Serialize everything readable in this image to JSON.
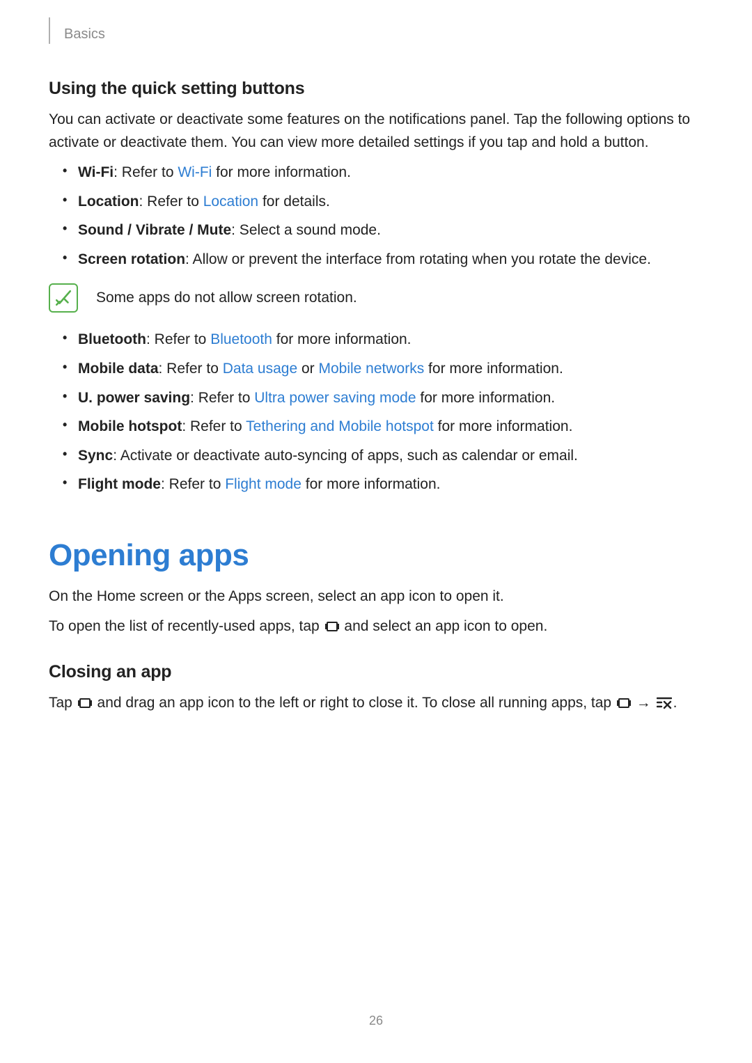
{
  "header": {
    "section": "Basics"
  },
  "section1": {
    "heading": "Using the quick setting buttons",
    "p1": "You can activate or deactivate some features on the notifications panel. Tap the following options to activate or deactivate them. You can view more detailed settings if you tap and hold a button.",
    "items1": [
      {
        "bold": "Wi-Fi",
        "pre": ": Refer to ",
        "link": "Wi-Fi",
        "post": " for more information."
      },
      {
        "bold": "Location",
        "pre": ": Refer to ",
        "link": "Location",
        "post": " for details."
      },
      {
        "bold": "Sound / Vibrate / Mute",
        "post_only": ": Select a sound mode."
      },
      {
        "bold": "Screen rotation",
        "post_only": ": Allow or prevent the interface from rotating when you rotate the device."
      }
    ],
    "note": "Some apps do not allow screen rotation.",
    "items2": [
      {
        "bold": "Bluetooth",
        "pre": ": Refer to ",
        "link": "Bluetooth",
        "post": " for more information."
      },
      {
        "bold": "Mobile data",
        "pre": ": Refer to ",
        "link": "Data usage",
        "mid": " or ",
        "link2": "Mobile networks",
        "post": " for more information."
      },
      {
        "bold": "U. power saving",
        "pre": ": Refer to ",
        "link": "Ultra power saving mode",
        "post": " for more information."
      },
      {
        "bold": "Mobile hotspot",
        "pre": ": Refer to ",
        "link": "Tethering and Mobile hotspot",
        "post": " for more information."
      },
      {
        "bold": "Sync",
        "post_only": ": Activate or deactivate auto-syncing of apps, such as calendar or email."
      },
      {
        "bold": "Flight mode",
        "pre": ": Refer to ",
        "link": "Flight mode",
        "post": " for more information."
      }
    ]
  },
  "section2": {
    "title": "Opening apps",
    "p1": "On the Home screen or the Apps screen, select an app icon to open it.",
    "p2_a": "To open the list of recently-used apps, tap ",
    "p2_b": " and select an app icon to open.",
    "sub": "Closing an app",
    "p3_a": "Tap ",
    "p3_b": " and drag an app icon to the left or right to close it. To close all running apps, tap ",
    "p3_c": " → ",
    "p3_d": "."
  },
  "page_number": "26"
}
